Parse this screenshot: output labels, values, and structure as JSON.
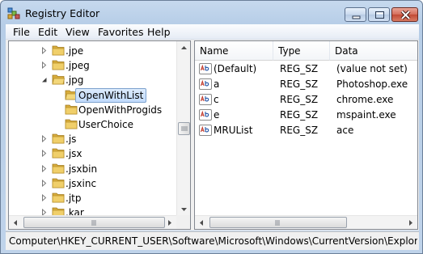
{
  "window": {
    "title": "Registry Editor"
  },
  "menu": [
    "File",
    "Edit",
    "View",
    "Favorites",
    "Help"
  ],
  "tree": {
    "items": [
      {
        "label": ".jpe",
        "level": 0,
        "expander": "collapsed"
      },
      {
        "label": ".jpeg",
        "level": 0,
        "expander": "collapsed"
      },
      {
        "label": ".jpg",
        "level": 0,
        "expander": "expanded"
      },
      {
        "label": "OpenWithList",
        "level": 1,
        "expander": "none",
        "selected": true
      },
      {
        "label": "OpenWithProgids",
        "level": 1,
        "expander": "none"
      },
      {
        "label": "UserChoice",
        "level": 1,
        "expander": "none"
      },
      {
        "label": ".js",
        "level": 0,
        "expander": "collapsed"
      },
      {
        "label": ".jsx",
        "level": 0,
        "expander": "collapsed"
      },
      {
        "label": ".jsxbin",
        "level": 0,
        "expander": "collapsed"
      },
      {
        "label": ".jsxinc",
        "level": 0,
        "expander": "collapsed"
      },
      {
        "label": ".jtp",
        "level": 0,
        "expander": "collapsed"
      },
      {
        "label": ".kar",
        "level": 0,
        "expander": "collapsed"
      }
    ]
  },
  "list": {
    "columns": [
      "Name",
      "Type",
      "Data"
    ],
    "rows": [
      {
        "name": "(Default)",
        "type": "REG_SZ",
        "data": "(value not set)"
      },
      {
        "name": "a",
        "type": "REG_SZ",
        "data": "Photoshop.exe"
      },
      {
        "name": "c",
        "type": "REG_SZ",
        "data": "chrome.exe"
      },
      {
        "name": "e",
        "type": "REG_SZ",
        "data": "mspaint.exe"
      },
      {
        "name": "MRUList",
        "type": "REG_SZ",
        "data": "ace"
      }
    ]
  },
  "status": {
    "path": "Computer\\HKEY_CURRENT_USER\\Software\\Microsoft\\Windows\\CurrentVersion\\Explorer\\FileExts\\.jpg\\OpenWithList"
  },
  "colors": {
    "folder": "#e8c15a",
    "selection": "#c1dbfc",
    "value_icon_text": "#c0392b"
  }
}
